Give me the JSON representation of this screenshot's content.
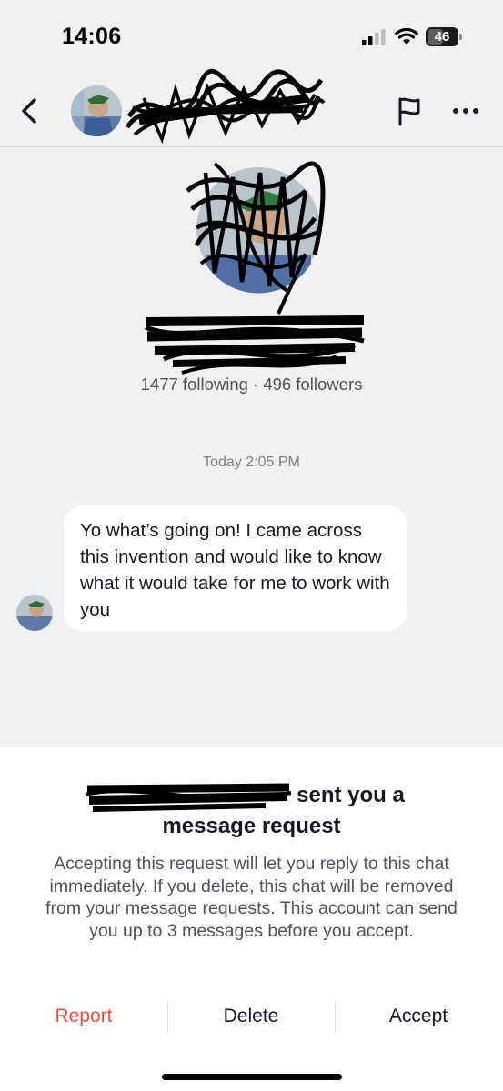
{
  "status_bar": {
    "time": "14:06",
    "battery": "46"
  },
  "header": {
    "back_icon": "chevron-left-icon",
    "flag_icon": "flag-icon",
    "more_icon": "more-horizontal-icon"
  },
  "profile": {
    "stats": "1477 following · 496 followers"
  },
  "chat": {
    "timestamp": "Today 2:05 PM",
    "message": "Yo what’s going on! I came across this invention and would like to know what it would take for me to work with you"
  },
  "request_sheet": {
    "title_line1": "sent you a",
    "title_line2": "message request",
    "body": "Accepting this request will let you reply to this chat immediately. If you delete, this chat will be removed from your message requests. This account can send you up to 3 messages before you accept.",
    "report_label": "Report",
    "delete_label": "Delete",
    "accept_label": "Accept"
  },
  "colors": {
    "background": "#f1f1f2",
    "report": "#e94e3f",
    "text": "#161823",
    "secondary_text": "#51525a"
  }
}
